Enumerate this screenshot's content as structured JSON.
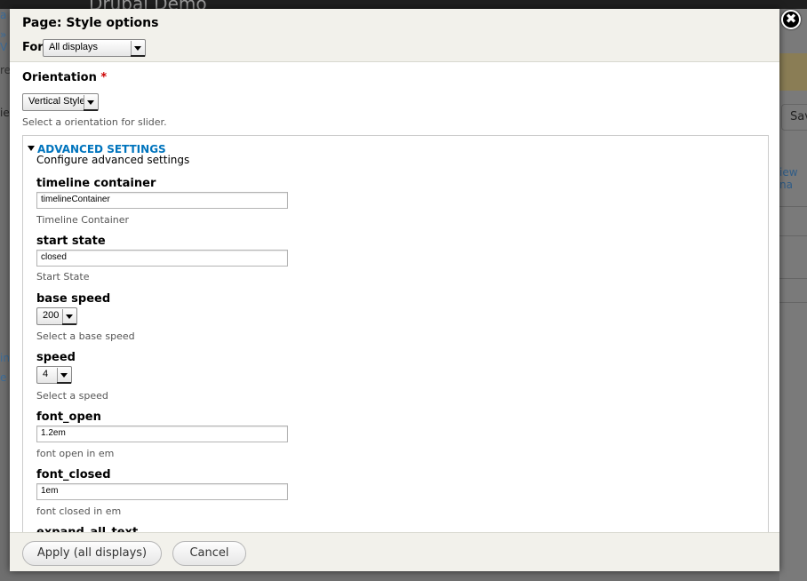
{
  "background": {
    "site_name": "Drupal Demo",
    "left_fragments": [
      "a",
      "» V",
      "re",
      "ie",
      "in",
      "e"
    ],
    "save_label": "Save",
    "view_name_fragment": "iew na"
  },
  "dialog": {
    "title": "Page: Style options",
    "for_label": "For",
    "for_value": "All displays",
    "close_glyph": "✖"
  },
  "orientation": {
    "label": "Orientation",
    "required_mark": "*",
    "value": "Vertical Style",
    "description": "Select a orientation for slider."
  },
  "advanced": {
    "legend": "ADVANCED SETTINGS",
    "description": "Configure advanced settings",
    "fields": {
      "timeline_container": {
        "label": "timeline container",
        "value": "timelineContainer",
        "description": "Timeline Container"
      },
      "start_state": {
        "label": "start state",
        "value": "closed",
        "description": "Start State"
      },
      "base_speed": {
        "label": "base speed",
        "value": "200",
        "description": "Select a base speed"
      },
      "speed": {
        "label": "speed",
        "value": "4",
        "description": "Select a speed"
      },
      "font_open": {
        "label": "font_open",
        "value": "1.2em",
        "description": "font open in em"
      },
      "font_closed": {
        "label": "font_closed",
        "value": "1em",
        "description": "font closed in em"
      },
      "expand_all_text": {
        "label": "expand_all_text"
      }
    }
  },
  "footer": {
    "apply_label": "Apply (all displays)",
    "cancel_label": "Cancel"
  },
  "colors": {
    "link_blue": "#0074bd",
    "required_red": "#cc0000",
    "header_bg": "#f2f1eb"
  }
}
